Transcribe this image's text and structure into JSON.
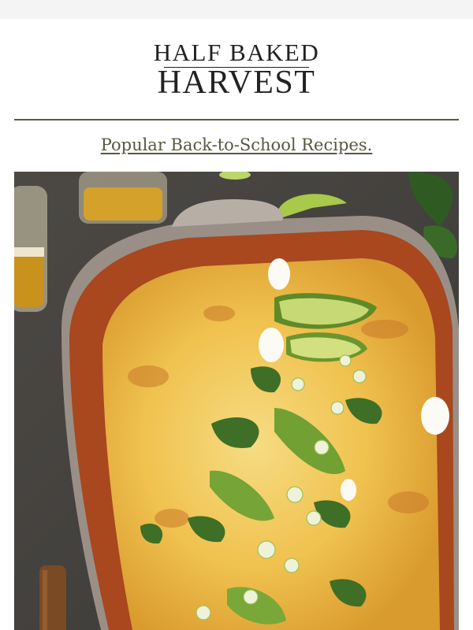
{
  "brand": {
    "logo_line1": "HALF BAKED",
    "logo_line2": "HARVEST"
  },
  "headline": {
    "text": "Popular Back-to-School Recipes."
  },
  "colors": {
    "page_bg": "#f4f4f4",
    "card_bg": "#ffffff",
    "divider": "#5b5a3d",
    "headline": "#595741",
    "logo": "#222222"
  },
  "hero_image": {
    "alt": "Enchilada casserole with avocado, basil and scallions"
  }
}
